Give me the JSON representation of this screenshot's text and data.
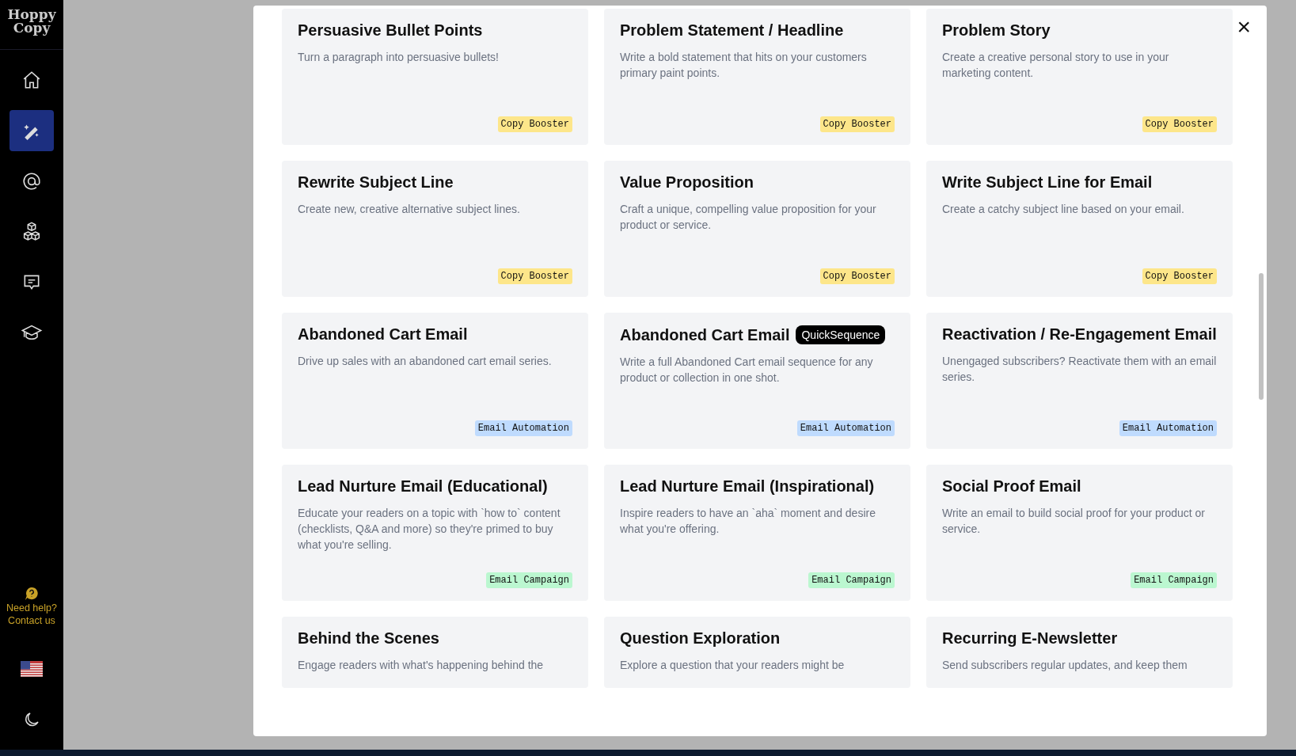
{
  "sidebar": {
    "logo": [
      "Hoppy",
      "Copy"
    ],
    "items": [
      {
        "kind": "home",
        "selected": false
      },
      {
        "kind": "wand",
        "selected": true
      },
      {
        "kind": "at",
        "selected": false
      },
      {
        "kind": "cubes",
        "selected": false
      },
      {
        "kind": "chat",
        "selected": false
      },
      {
        "kind": "cap",
        "selected": false
      }
    ],
    "help": [
      "Need help?",
      "Contact us"
    ]
  },
  "modal": {
    "close": "×",
    "cards": [
      {
        "title": "Persuasive Bullet Points",
        "description": "Turn a paragraph into persuasive bullets!",
        "tag": "Copy Booster",
        "color": "#fde68a"
      },
      {
        "title": "Problem Statement / Headline",
        "description": "Write a bold statement that hits on your customers primary paint points.",
        "tag": "Copy Booster",
        "color": "#fde68a"
      },
      {
        "title": "Problem Story",
        "description": "Create a creative personal story to use in your marketing content.",
        "tag": "Copy Booster",
        "color": "#fde68a"
      },
      {
        "title": "Rewrite Subject Line",
        "description": "Create new, creative alternative subject lines.",
        "tag": "Copy Booster",
        "color": "#fde68a"
      },
      {
        "title": "Value Proposition",
        "description": "Craft a unique, compelling value proposition for your product or service.",
        "tag": "Copy Booster",
        "color": "#fde68a"
      },
      {
        "title": "Write Subject Line for Email",
        "description": "Create a catchy subject line based on your email.",
        "tag": "Copy Booster",
        "color": "#fde68a"
      },
      {
        "title": "Abandoned Cart Email",
        "description": "Drive up sales with an abandoned cart email series.",
        "tag": "Email Automation",
        "color": "#bfdbfe"
      },
      {
        "title": "Abandoned Cart Email",
        "badge": "QuickSequence",
        "description": "Write a full Abandoned Cart email sequence for any product or collection in one shot.",
        "tag": "Email Automation",
        "color": "#bfdbfe"
      },
      {
        "title": "Reactivation / Re-Engagement Email",
        "description": "Unengaged subscribers? Reactivate them with an email series.",
        "tag": "Email Automation",
        "color": "#bfdbfe"
      },
      {
        "title": "Lead Nurture Email (Educational)",
        "description": "Educate your readers on a topic with `how to` content (checklists, Q&A and more) so they're primed to buy what you're selling.",
        "tag": "Email Campaign",
        "color": "#bbf7d0"
      },
      {
        "title": "Lead Nurture Email (Inspirational)",
        "description": "Inspire readers to have an `aha` moment and desire what you're offering.",
        "tag": "Email Campaign",
        "color": "#bbf7d0"
      },
      {
        "title": "Social Proof Email",
        "description": "Write an email to build social proof for your product or service.",
        "tag": "Email Campaign",
        "color": "#bbf7d0"
      },
      {
        "title": "Behind the Scenes",
        "description": "Engage readers with what's happening behind the"
      },
      {
        "title": "Question Exploration",
        "description": "Explore a question that your readers might be"
      },
      {
        "title": "Recurring E-Newsletter",
        "description": "Send subscribers regular updates, and keep them"
      }
    ]
  }
}
